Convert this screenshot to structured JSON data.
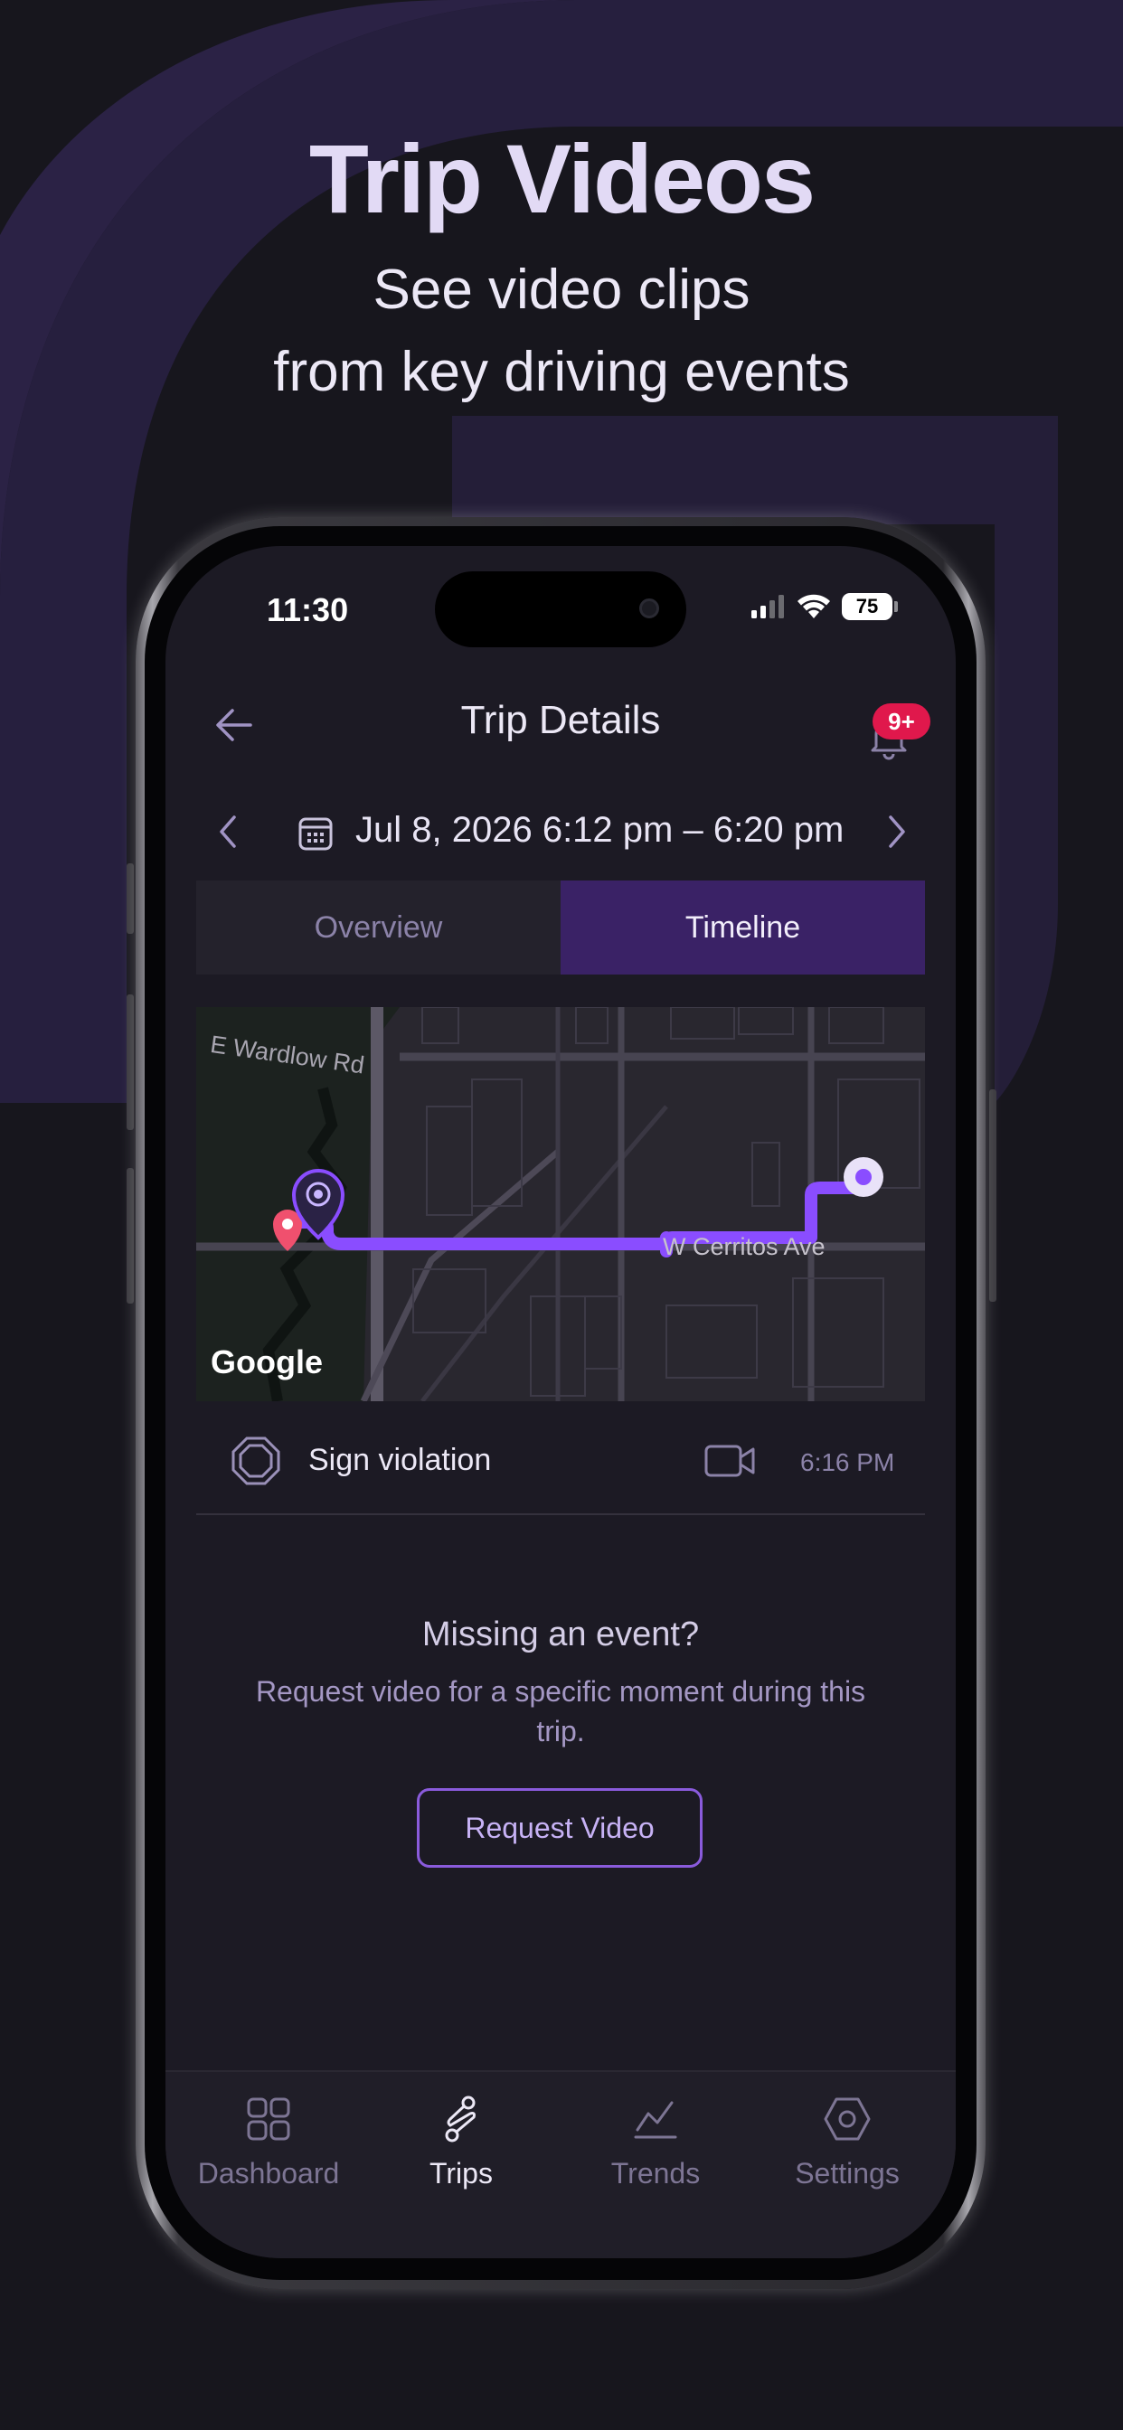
{
  "promo": {
    "title": "Trip Videos",
    "subtitle_line1": "See video clips",
    "subtitle_line2": "from key driving events"
  },
  "status_bar": {
    "time": "11:30",
    "battery": "75"
  },
  "header": {
    "title": "Trip Details",
    "notification_badge": "9+"
  },
  "date_range": {
    "label": "Jul 8, 2026 6:12 pm – 6:20 pm"
  },
  "tabs": [
    {
      "label": "Overview",
      "active": false
    },
    {
      "label": "Timeline",
      "active": true
    }
  ],
  "map": {
    "street_labels": [
      "E Wardlow Rd",
      "W Cerritos Ave"
    ],
    "attribution": "Google",
    "route_color": "#8a4dff",
    "start_marker_color": "#f0506e"
  },
  "event": {
    "label": "Sign violation",
    "time": "6:16 PM",
    "icon": "octagon-sign-icon",
    "video_icon": "video-camera-icon"
  },
  "missing_event": {
    "title": "Missing an event?",
    "text": "Request video for a specific moment during this trip.",
    "button_label": "Request Video"
  },
  "tab_bar": [
    {
      "label": "Dashboard",
      "icon": "grid-icon",
      "active": false
    },
    {
      "label": "Trips",
      "icon": "route-icon",
      "active": true
    },
    {
      "label": "Trends",
      "icon": "trend-chart-icon",
      "active": false
    },
    {
      "label": "Settings",
      "icon": "hexagon-gear-icon",
      "active": false
    }
  ],
  "colors": {
    "accent": "#3a2266",
    "badge": "#e0184c",
    "background": "#17161d"
  }
}
